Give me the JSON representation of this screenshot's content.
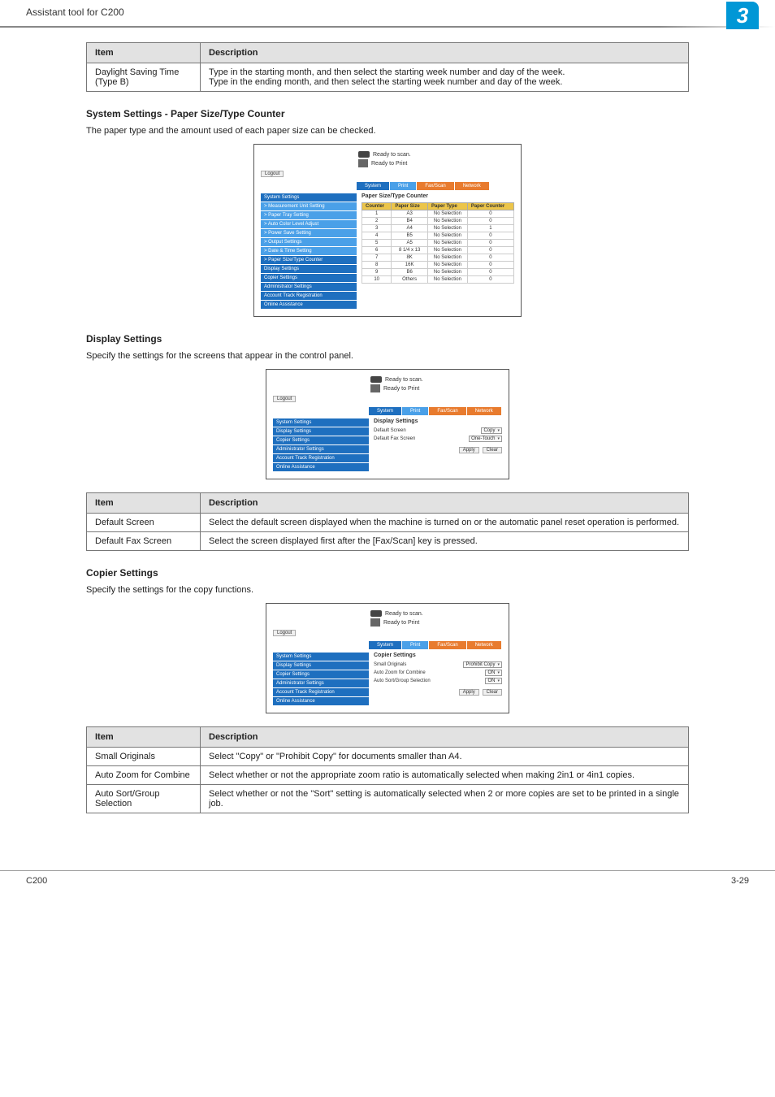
{
  "header": {
    "left_text": "Assistant tool for C200",
    "chapter_num": "3"
  },
  "table_daylight": {
    "headers": [
      "Item",
      "Description"
    ],
    "rows": [
      {
        "item": "Daylight Saving Time (Type B)",
        "desc": "Type in the starting month, and then select the starting week number and day of the week.\nType in the ending month, and then select the starting week number and day of the week."
      }
    ]
  },
  "section_paper": {
    "title": "System Settings - Paper Size/Type Counter",
    "desc": "The paper type and the amount used of each paper size can be checked."
  },
  "shot_paper": {
    "status": [
      "Ready to scan.",
      "Ready to Print"
    ],
    "logout": "Logout",
    "tabs": [
      "System",
      "Print",
      "Fax/Scan",
      "Network"
    ],
    "sidebar": [
      {
        "label": "System Settings",
        "light": false
      },
      {
        "label": "> Measurement Unit Setting",
        "light": true
      },
      {
        "label": "> Paper Tray Setting",
        "light": true
      },
      {
        "label": "> Auto Color Level Adjust",
        "light": true
      },
      {
        "label": "> Power Save Setting",
        "light": true
      },
      {
        "label": "> Output Settings",
        "light": true
      },
      {
        "label": "> Date & Time Setting",
        "light": true
      },
      {
        "label": "> Paper Size/Type Counter",
        "light": false
      },
      {
        "label": "Display Settings",
        "light": false
      },
      {
        "label": "Copier Settings",
        "light": false
      },
      {
        "label": "Administrator Settings",
        "light": false
      },
      {
        "label": "Account Track Registration",
        "light": false
      },
      {
        "label": "Online Assistance",
        "light": false
      }
    ],
    "content_title": "Paper Size/Type Counter",
    "table_headers": [
      "Counter",
      "Paper Size",
      "Paper Type",
      "Paper Counter"
    ],
    "table_rows": [
      [
        "1",
        "A3",
        "No Selection",
        "0"
      ],
      [
        "2",
        "B4",
        "No Selection",
        "0"
      ],
      [
        "3",
        "A4",
        "No Selection",
        "1"
      ],
      [
        "4",
        "B5",
        "No Selection",
        "0"
      ],
      [
        "5",
        "A5",
        "No Selection",
        "0"
      ],
      [
        "6",
        "8 1/4 x 13",
        "No Selection",
        "0"
      ],
      [
        "7",
        "8K",
        "No Selection",
        "0"
      ],
      [
        "8",
        "16K",
        "No Selection",
        "0"
      ],
      [
        "9",
        "B6",
        "No Selection",
        "0"
      ],
      [
        "10",
        "Others",
        "No Selection",
        "0"
      ]
    ]
  },
  "section_display": {
    "title": "Display Settings",
    "desc": "Specify the settings for the screens that appear in the control panel."
  },
  "shot_display": {
    "sidebar": [
      {
        "label": "System Settings",
        "light": false
      },
      {
        "label": "Display Settings",
        "light": false
      },
      {
        "label": "Copier Settings",
        "light": false
      },
      {
        "label": "Administrator Settings",
        "light": false
      },
      {
        "label": "Account Track Registration",
        "light": false
      },
      {
        "label": "Online Assistance",
        "light": false
      }
    ],
    "content_title": "Display Settings",
    "fields": [
      {
        "label": "Default Screen",
        "value": "Copy"
      },
      {
        "label": "Default Fax Screen",
        "value": "One-Touch"
      }
    ],
    "buttons": [
      "Apply",
      "Clear"
    ]
  },
  "table_display": {
    "headers": [
      "Item",
      "Description"
    ],
    "rows": [
      {
        "item": "Default Screen",
        "desc": "Select the default screen displayed when the machine is turned on or the automatic panel reset operation is performed."
      },
      {
        "item": "Default Fax Screen",
        "desc": "Select the screen displayed first after the [Fax/Scan] key is pressed."
      }
    ]
  },
  "section_copier": {
    "title": "Copier Settings",
    "desc": "Specify the settings for the copy functions."
  },
  "shot_copier": {
    "sidebar": [
      {
        "label": "System Settings",
        "light": false
      },
      {
        "label": "Display Settings",
        "light": false
      },
      {
        "label": "Copier Settings",
        "light": false
      },
      {
        "label": "Administrator Settings",
        "light": false
      },
      {
        "label": "Account Track Registration",
        "light": false
      },
      {
        "label": "Online Assistance",
        "light": false
      }
    ],
    "content_title": "Copier Settings",
    "fields": [
      {
        "label": "Small Originals",
        "value": "Prohibit Copy"
      },
      {
        "label": "Auto Zoom for Combine",
        "value": "ON"
      },
      {
        "label": "Auto Sort/Group Selection",
        "value": "ON"
      }
    ],
    "buttons": [
      "Apply",
      "Clear"
    ]
  },
  "table_copier": {
    "headers": [
      "Item",
      "Description"
    ],
    "rows": [
      {
        "item": "Small Originals",
        "desc": "Select \"Copy\" or \"Prohibit Copy\" for documents smaller than A4."
      },
      {
        "item": "Auto Zoom for Combine",
        "desc": "Select whether or not the appropriate zoom ratio is automatically selected when making 2in1 or 4in1 copies."
      },
      {
        "item": "Auto Sort/Group Selection",
        "desc": "Select whether or not the \"Sort\" setting is automatically selected when 2 or more copies are set to be printed in a single job."
      }
    ]
  },
  "footer": {
    "left": "C200",
    "right": "3-29"
  }
}
